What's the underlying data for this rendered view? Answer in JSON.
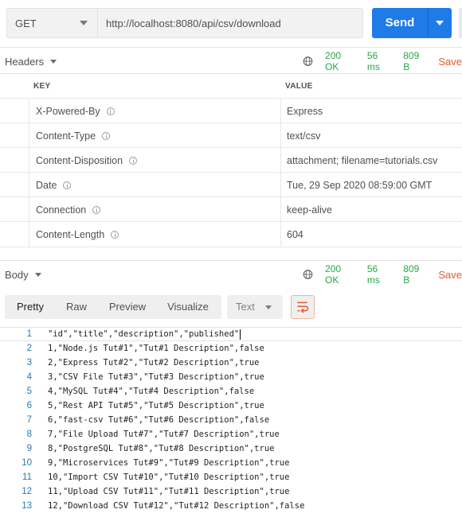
{
  "request": {
    "method": "GET",
    "url": "http://localhost:8080/api/csv/download",
    "send_label": "Send"
  },
  "headers_section": {
    "title": "Headers",
    "status": "200 OK",
    "time": "56 ms",
    "size": "809 B",
    "save_label": "Save",
    "columns": {
      "key": "KEY",
      "value": "VALUE"
    },
    "rows": [
      {
        "key": "X-Powered-By",
        "value": "Express"
      },
      {
        "key": "Content-Type",
        "value": "text/csv"
      },
      {
        "key": "Content-Disposition",
        "value": "attachment; filename=tutorials.csv"
      },
      {
        "key": "Date",
        "value": "Tue, 29 Sep 2020 08:59:00 GMT"
      },
      {
        "key": "Connection",
        "value": "keep-alive"
      },
      {
        "key": "Content-Length",
        "value": "604"
      }
    ]
  },
  "body_section": {
    "title": "Body",
    "status": "200 OK",
    "time": "56 ms",
    "size": "809 B",
    "save_label": "Save",
    "tabs": [
      "Pretty",
      "Raw",
      "Preview",
      "Visualize"
    ],
    "active_tab": "Pretty",
    "format": "Text",
    "lines": [
      {
        "n": "1",
        "text": "\"id\",\"title\",\"description\",\"published\""
      },
      {
        "n": "2",
        "text": "1,\"Node.js Tut#1\",\"Tut#1 Description\",false"
      },
      {
        "n": "3",
        "text": "2,\"Express Tut#2\",\"Tut#2 Description\",true"
      },
      {
        "n": "4",
        "text": "3,\"CSV File Tut#3\",\"Tut#3 Description\",true"
      },
      {
        "n": "5",
        "text": "4,\"MySQL Tut#4\",\"Tut#4 Description\",false"
      },
      {
        "n": "6",
        "text": "5,\"Rest API Tut#5\",\"Tut#5 Description\",true"
      },
      {
        "n": "7",
        "text": "6,\"fast-csv Tut#6\",\"Tut#6 Description\",false"
      },
      {
        "n": "8",
        "text": "7,\"File Upload Tut#7\",\"Tut#7 Description\",true"
      },
      {
        "n": "9",
        "text": "8,\"PostgreSQL Tut#8\",\"Tut#8 Description\",true"
      },
      {
        "n": "10",
        "text": "9,\"Microservices Tut#9\",\"Tut#9 Description\",true"
      },
      {
        "n": "11",
        "text": "10,\"Import CSV Tut#10\",\"Tut#10 Description\",true"
      },
      {
        "n": "12",
        "text": "11,\"Upload CSV Tut#11\",\"Tut#11 Description\",true"
      },
      {
        "n": "13",
        "text": "12,\"Download CSV Tut#12\",\"Tut#12 Description\",false"
      }
    ]
  },
  "colors": {
    "send_button": "#1f7be8",
    "status_ok": "#28a745",
    "save": "#e05a2b",
    "line_number": "#2a7ab0"
  },
  "icons": [
    "chevron-down-icon",
    "globe-icon",
    "info-icon",
    "wrap-lines-icon"
  ]
}
